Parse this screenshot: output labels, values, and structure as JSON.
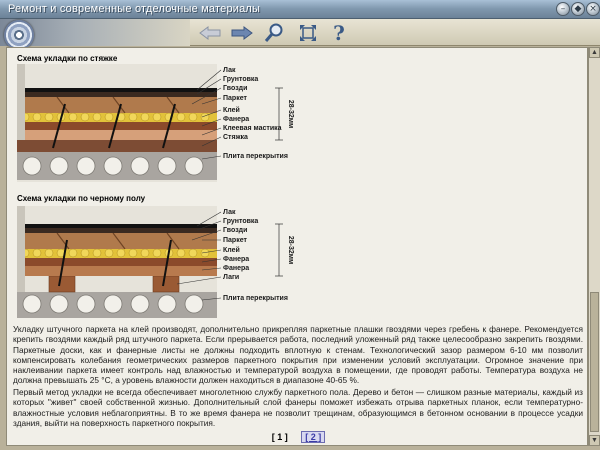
{
  "window": {
    "title": "Ремонт и современные отделочные материалы",
    "buttons": [
      "minimize",
      "maximize",
      "close"
    ]
  },
  "toolbar": {
    "icons": [
      "back-arrow-icon",
      "forward-arrow-icon",
      "magnifier-icon",
      "fullscreen-icon",
      "help-icon"
    ],
    "help_glyph": "?"
  },
  "section1": {
    "heading": "Схема укладки по стяжке",
    "labels": [
      "Лак",
      "Грунтовка",
      "Гвозди",
      "Паркет",
      "Клей",
      "Фанера",
      "Клеевая мастика",
      "Стяжка",
      "Плита перекрытия"
    ],
    "dimension": "28-32мм"
  },
  "section2": {
    "heading": "Схема укладки по черному полу",
    "labels": [
      "Лак",
      "Грунтовка",
      "Гвозди",
      "Паркет",
      "Клей",
      "Фанера",
      "Фанера",
      "Лаги",
      "Плита перекрытия"
    ],
    "dimension": "28-32мм"
  },
  "paragraphs": [
    "Укладку штучного паркета на клей производят, дополнительно прикрепляя паркетные плашки гвоздями через гребень к фанере. Рекомендуется крепить гвоздями каждый ряд штучного паркета. Если прерывается работа, последний уложенный ряд также целесообразно закрепить гвоздями. Паркетные доски, как и фанерные листы не должны подходить вплотную к стенам. Технологический зазор размером 6-10 мм позволит компенсировать колебания геометрических размеров паркетного покрытия при изменении условий эксплуатации. Огромное значение при наклеивании паркета имеет контроль над влажностью и температурой воздуха в помещении, где проводят работы. Температура воздуха не должна превышать 25 °С, а уровень влажности должен находиться в диапазоне 40-65 %.",
    "Первый метод укладки не всегда обеспечивает многолетнюю службу паркетного пола. Дерево и бетон — слишком разные материалы, каждый из которых \"живет\" своей собственной жизнью. Дополнительный слой фанеры поможет избежать отрыва паркетных планок, если температурно-влажностные условия неблагоприятны. В то же время фанера не позволит трещинам, образующимся в бетонном основании в процессе усадки здания, выйти на поверхность паркетного покрытия."
  ],
  "pager": {
    "current": "[ 1 ]",
    "next": "[ 2 ]"
  }
}
